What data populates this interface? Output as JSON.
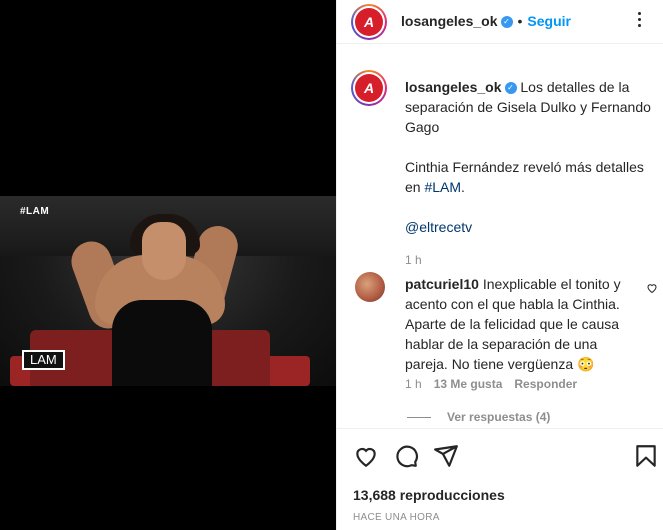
{
  "media": {
    "tag": "#LAM",
    "logo": "LAM"
  },
  "header": {
    "username": "losangeles_ok",
    "verified": "✓",
    "separator": "•",
    "follow_label": "Seguir"
  },
  "caption": {
    "username": "losangeles_ok",
    "line1": "Los detalles de la separación de Gisela Dulko y Fernando Gago",
    "line2_prefix": "Cinthia Fernández reveló más detalles en ",
    "hashtag": "#LAM",
    "line2_suffix": ".",
    "mention": "@eltrecetv",
    "time": "1 h"
  },
  "comment": {
    "username": "patcuriel10",
    "text": "Inexplicable el tonito y acento con el que habla la Cinthia. Aparte de la felicidad que le causa hablar de la separación de una pareja. No tiene vergüenza 😳",
    "time": "1 h",
    "likes": "13 Me gusta",
    "reply_label": "Responder",
    "view_replies": "Ver respuestas (4)"
  },
  "stats": {
    "views": "13,688 reproducciones",
    "posted": "HACE UNA HORA"
  },
  "colors": {
    "accent": "#0095f6",
    "brand_red": "#d61f2b",
    "verified": "#3897f0"
  }
}
